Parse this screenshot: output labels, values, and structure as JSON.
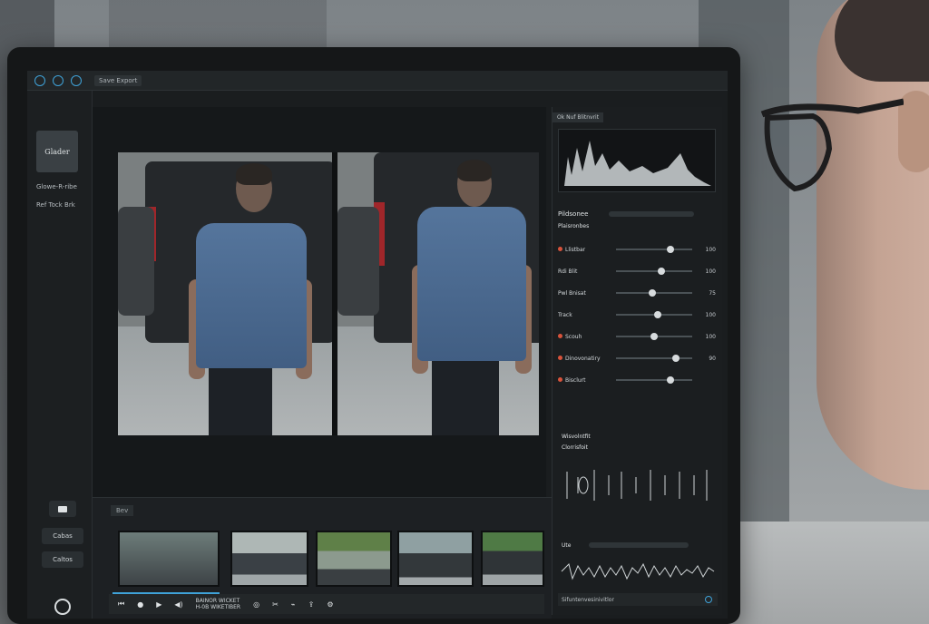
{
  "app": {
    "menu_label": "Save  Export",
    "badge_label": "Glader",
    "rail_line1": "Glowe-R-ribe",
    "rail_line2": "Ref Tock Brk",
    "rail_btn1_label": "",
    "rail_btn2_label": "Cabas",
    "rail_btn3_label": "Caltos"
  },
  "timeline": {
    "header": "Bev",
    "transport_text_line1": "BAINOR WICKET",
    "transport_text_line2": "H-0B WIKETIBER"
  },
  "right_panel": {
    "tag": "Ok Nuf Blitnvrit",
    "section_title": "Pildsonee",
    "section_subtitle": "Plaisronbes",
    "sliders": [
      {
        "label": "Llistbar",
        "value": "100",
        "knob": 0.72,
        "dot": true
      },
      {
        "label": "Rdi Blit",
        "value": "100",
        "knob": 0.6,
        "dot": false
      },
      {
        "label": "Pwl Bnisat",
        "value": "75",
        "knob": 0.48,
        "dot": false
      },
      {
        "label": "Track",
        "value": "100",
        "knob": 0.55,
        "dot": false
      },
      {
        "label": "Scouh",
        "value": "100",
        "knob": 0.5,
        "dot": true
      },
      {
        "label": "Dinovonatiry",
        "value": "90",
        "knob": 0.78,
        "dot": true
      },
      {
        "label": "Bisclurt",
        "value": "",
        "knob": 0.72,
        "dot": true
      }
    ],
    "extra_label1": "Wisvolntfit",
    "extra_label2": "Clorrisfoit",
    "lower_label": "Ute",
    "footer_text": "Sifuntenvesinivitlor"
  },
  "colors": {
    "accent": "#3fa2d8",
    "shirt": "#4f6f97",
    "status_red": "#d8533b"
  }
}
